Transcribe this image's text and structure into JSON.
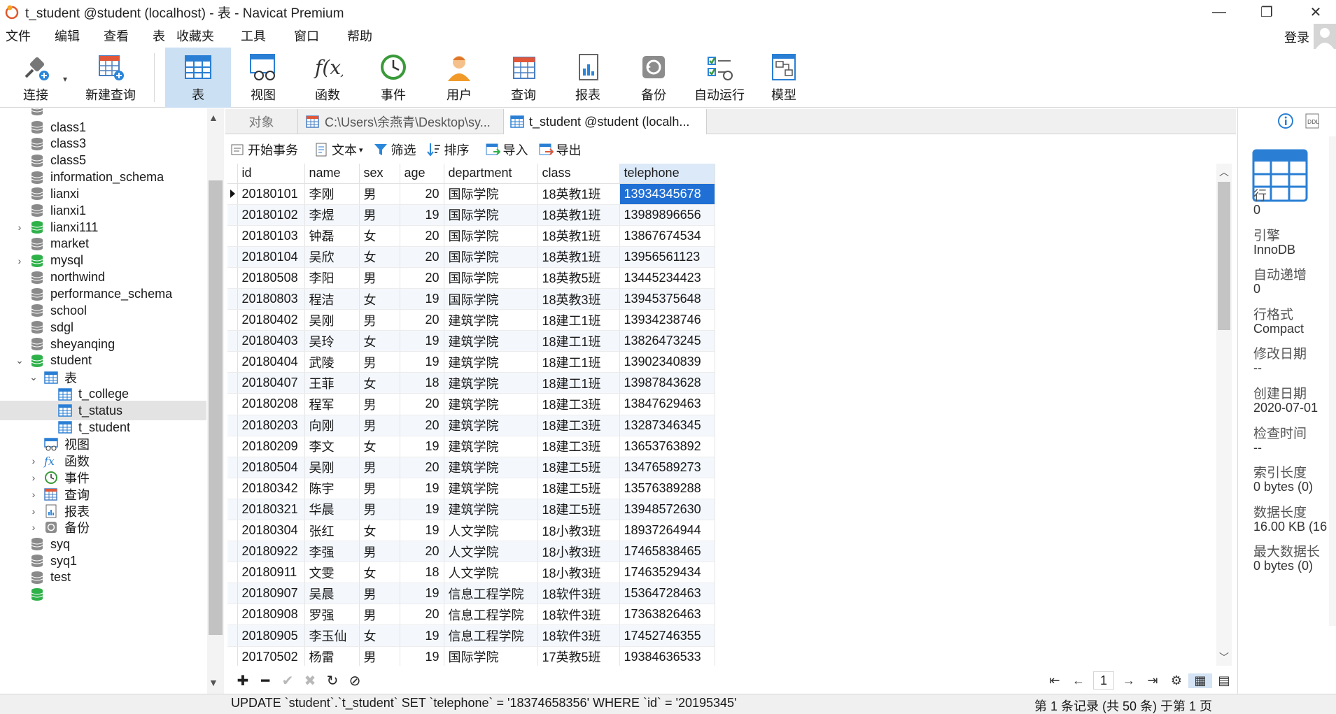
{
  "window": {
    "title": "t_student @student (localhost) - 表 - Navicat Premium",
    "min": "—",
    "restore": "❐",
    "close": "✕"
  },
  "menu": [
    "文件",
    "编辑",
    "查看",
    "表",
    "收藏夹",
    "工具",
    "窗口",
    "帮助"
  ],
  "login": "登录",
  "toolbar": {
    "connect": "连接",
    "new_query": "新建查询",
    "table": "表",
    "view": "视图",
    "function": "函数",
    "event": "事件",
    "user": "用户",
    "query": "查询",
    "report": "报表",
    "backup": "备份",
    "autorun": "自动运行",
    "model": "模型"
  },
  "sidebar": {
    "items": [
      {
        "label": "class1"
      },
      {
        "label": "class3"
      },
      {
        "label": "class5"
      },
      {
        "label": "information_schema"
      },
      {
        "label": "lianxi"
      },
      {
        "label": "lianxi1"
      },
      {
        "label": "lianxi111"
      },
      {
        "label": "market"
      },
      {
        "label": "mysql"
      },
      {
        "label": "northwind"
      },
      {
        "label": "performance_schema"
      },
      {
        "label": "school"
      },
      {
        "label": "sdgl"
      },
      {
        "label": "sheyanqing"
      },
      {
        "label": "student"
      },
      {
        "label": "表"
      },
      {
        "label": "t_college"
      },
      {
        "label": "t_status"
      },
      {
        "label": "t_student"
      },
      {
        "label": "视图"
      },
      {
        "label": "函数"
      },
      {
        "label": "事件"
      },
      {
        "label": "查询"
      },
      {
        "label": "报表"
      },
      {
        "label": "备份"
      },
      {
        "label": "syq"
      },
      {
        "label": "syq1"
      },
      {
        "label": "test"
      }
    ]
  },
  "tabs": {
    "objects": "对象",
    "file_tab": "C:\\Users\\余燕青\\Desktop\\sy...",
    "table_tab": "t_student @student (localh..."
  },
  "subtoolbar": {
    "begin_tx": "开始事务",
    "text": "文本",
    "filter": "筛选",
    "sort": "排序",
    "import": "导入",
    "export": "导出"
  },
  "grid": {
    "columns": [
      "id",
      "name",
      "sex",
      "age",
      "department",
      "class",
      "telephone"
    ],
    "rows": [
      [
        "20180101",
        "李刚",
        "男",
        "20",
        "国际学院",
        "18英教1班",
        "13934345678"
      ],
      [
        "20180102",
        "李煜",
        "男",
        "19",
        "国际学院",
        "18英教1班",
        "13989896656"
      ],
      [
        "20180103",
        "钟磊",
        "女",
        "20",
        "国际学院",
        "18英教1班",
        "13867674534"
      ],
      [
        "20180104",
        "吴欣",
        "女",
        "20",
        "国际学院",
        "18英教1班",
        "13956561123"
      ],
      [
        "20180508",
        "李阳",
        "男",
        "20",
        "国际学院",
        "18英教5班",
        "13445234423"
      ],
      [
        "20180803",
        "程洁",
        "女",
        "19",
        "国际学院",
        "18英教3班",
        "13945375648"
      ],
      [
        "20180402",
        "吴刚",
        "男",
        "20",
        "建筑学院",
        "18建工1班",
        "13934238746"
      ],
      [
        "20180403",
        "吴玲",
        "女",
        "19",
        "建筑学院",
        "18建工1班",
        "13826473245"
      ],
      [
        "20180404",
        "武陵",
        "男",
        "19",
        "建筑学院",
        "18建工1班",
        "13902340839"
      ],
      [
        "20180407",
        "王菲",
        "女",
        "18",
        "建筑学院",
        "18建工1班",
        "13987843628"
      ],
      [
        "20180208",
        "程军",
        "男",
        "20",
        "建筑学院",
        "18建工3班",
        "13847629463"
      ],
      [
        "20180203",
        "向刚",
        "男",
        "20",
        "建筑学院",
        "18建工3班",
        "13287346345"
      ],
      [
        "20180209",
        "李文",
        "女",
        "19",
        "建筑学院",
        "18建工3班",
        "13653763892"
      ],
      [
        "20180504",
        "吴刚",
        "男",
        "20",
        "建筑学院",
        "18建工5班",
        "13476589273"
      ],
      [
        "20180342",
        "陈宇",
        "男",
        "19",
        "建筑学院",
        "18建工5班",
        "13576389288"
      ],
      [
        "20180321",
        "华晨",
        "男",
        "19",
        "建筑学院",
        "18建工5班",
        "13948572630"
      ],
      [
        "20180304",
        "张红",
        "女",
        "19",
        "人文学院",
        "18小教3班",
        "18937264944"
      ],
      [
        "20180922",
        "李强",
        "男",
        "20",
        "人文学院",
        "18小教3班",
        "17465838465"
      ],
      [
        "20180911",
        "文雯",
        "女",
        "18",
        "人文学院",
        "18小教3班",
        "17463529434"
      ],
      [
        "20180907",
        "吴晨",
        "男",
        "19",
        "信息工程学院",
        "18软件3班",
        "15364728463"
      ],
      [
        "20180908",
        "罗强",
        "男",
        "20",
        "信息工程学院",
        "18软件3班",
        "17363826463"
      ],
      [
        "20180905",
        "李玉仙",
        "女",
        "19",
        "信息工程学院",
        "18软件3班",
        "17452746355"
      ],
      [
        "20170502",
        "杨雷",
        "男",
        "19",
        "国际学院",
        "17英教5班",
        "19384636533"
      ]
    ]
  },
  "pager": {
    "page": "1"
  },
  "status": {
    "sql": "UPDATE `student`.`t_student` SET `telephone` = '18374658356' WHERE `id` = '20195345'",
    "records": "第 1 条记录 (共 50 条) 于第 1 页"
  },
  "info_panel": [
    {
      "label": "行",
      "value": "0"
    },
    {
      "label": "引擎",
      "value": "InnoDB"
    },
    {
      "label": "自动递增",
      "value": "0"
    },
    {
      "label": "行格式",
      "value": "Compact"
    },
    {
      "label": "修改日期",
      "value": "--"
    },
    {
      "label": "创建日期",
      "value": "2020-07-01"
    },
    {
      "label": "检查时间",
      "value": "--"
    },
    {
      "label": "索引长度",
      "value": "0 bytes (0)"
    },
    {
      "label": "数据长度",
      "value": "16.00 KB (16"
    },
    {
      "label": "最大数据长",
      "value": "0 bytes (0)"
    }
  ],
  "colors": {
    "accent": "#1f6fd4",
    "active_tool": "#cce0f4",
    "db_green": "#2fb14a",
    "db_gray": "#8a8a8a"
  }
}
